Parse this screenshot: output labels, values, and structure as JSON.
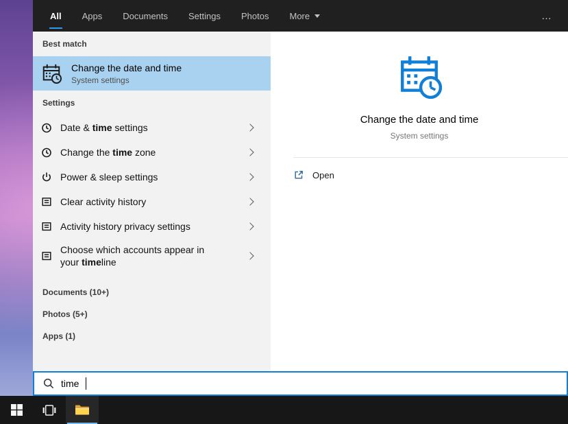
{
  "tabs": {
    "all": "All",
    "apps": "Apps",
    "documents": "Documents",
    "settings": "Settings",
    "photos": "Photos",
    "more": "More",
    "overflow": "…"
  },
  "left": {
    "best_match_header": "Best match",
    "best_match_title": "Change the date and time",
    "best_match_subtitle": "System settings",
    "settings_header": "Settings",
    "settings_items": [
      {
        "pre": "Date & ",
        "bold": "time",
        "post": " settings",
        "icon": "clock-icon"
      },
      {
        "pre": "Change the ",
        "bold": "time",
        "post": " zone",
        "icon": "clock-icon"
      },
      {
        "pre": "Power & sleep settings",
        "bold": "",
        "post": "",
        "icon": "power-icon"
      },
      {
        "pre": "Clear activity history",
        "bold": "",
        "post": "",
        "icon": "activity-history-icon"
      },
      {
        "pre": "Activity history privacy settings",
        "bold": "",
        "post": "",
        "icon": "activity-history-icon"
      },
      {
        "pre": "Choose which accounts appear in your ",
        "bold": "time",
        "post": "line",
        "icon": "activity-history-icon"
      }
    ],
    "documents_header": "Documents (10+)",
    "photos_header": "Photos (5+)",
    "apps_header": "Apps (1)"
  },
  "preview": {
    "title": "Change the date and time",
    "subtitle": "System settings",
    "open_label": "Open"
  },
  "search": {
    "value": "time"
  },
  "icons": {
    "best_match": "calendar-clock-icon",
    "preview_hero": "calendar-clock-icon",
    "open_action": "open-external-icon",
    "search": "search-icon",
    "taskbar": [
      "windows-logo-icon",
      "task-view-icon",
      "file-explorer-folder-icon"
    ]
  },
  "colors": {
    "accent": "#0f7fd7",
    "best_match_highlight": "#a9d2f0",
    "tab_underline": "#2e9be6",
    "taskbar_underline": "#76b9ed",
    "hero_icon_blue": "#0f7fd7"
  }
}
